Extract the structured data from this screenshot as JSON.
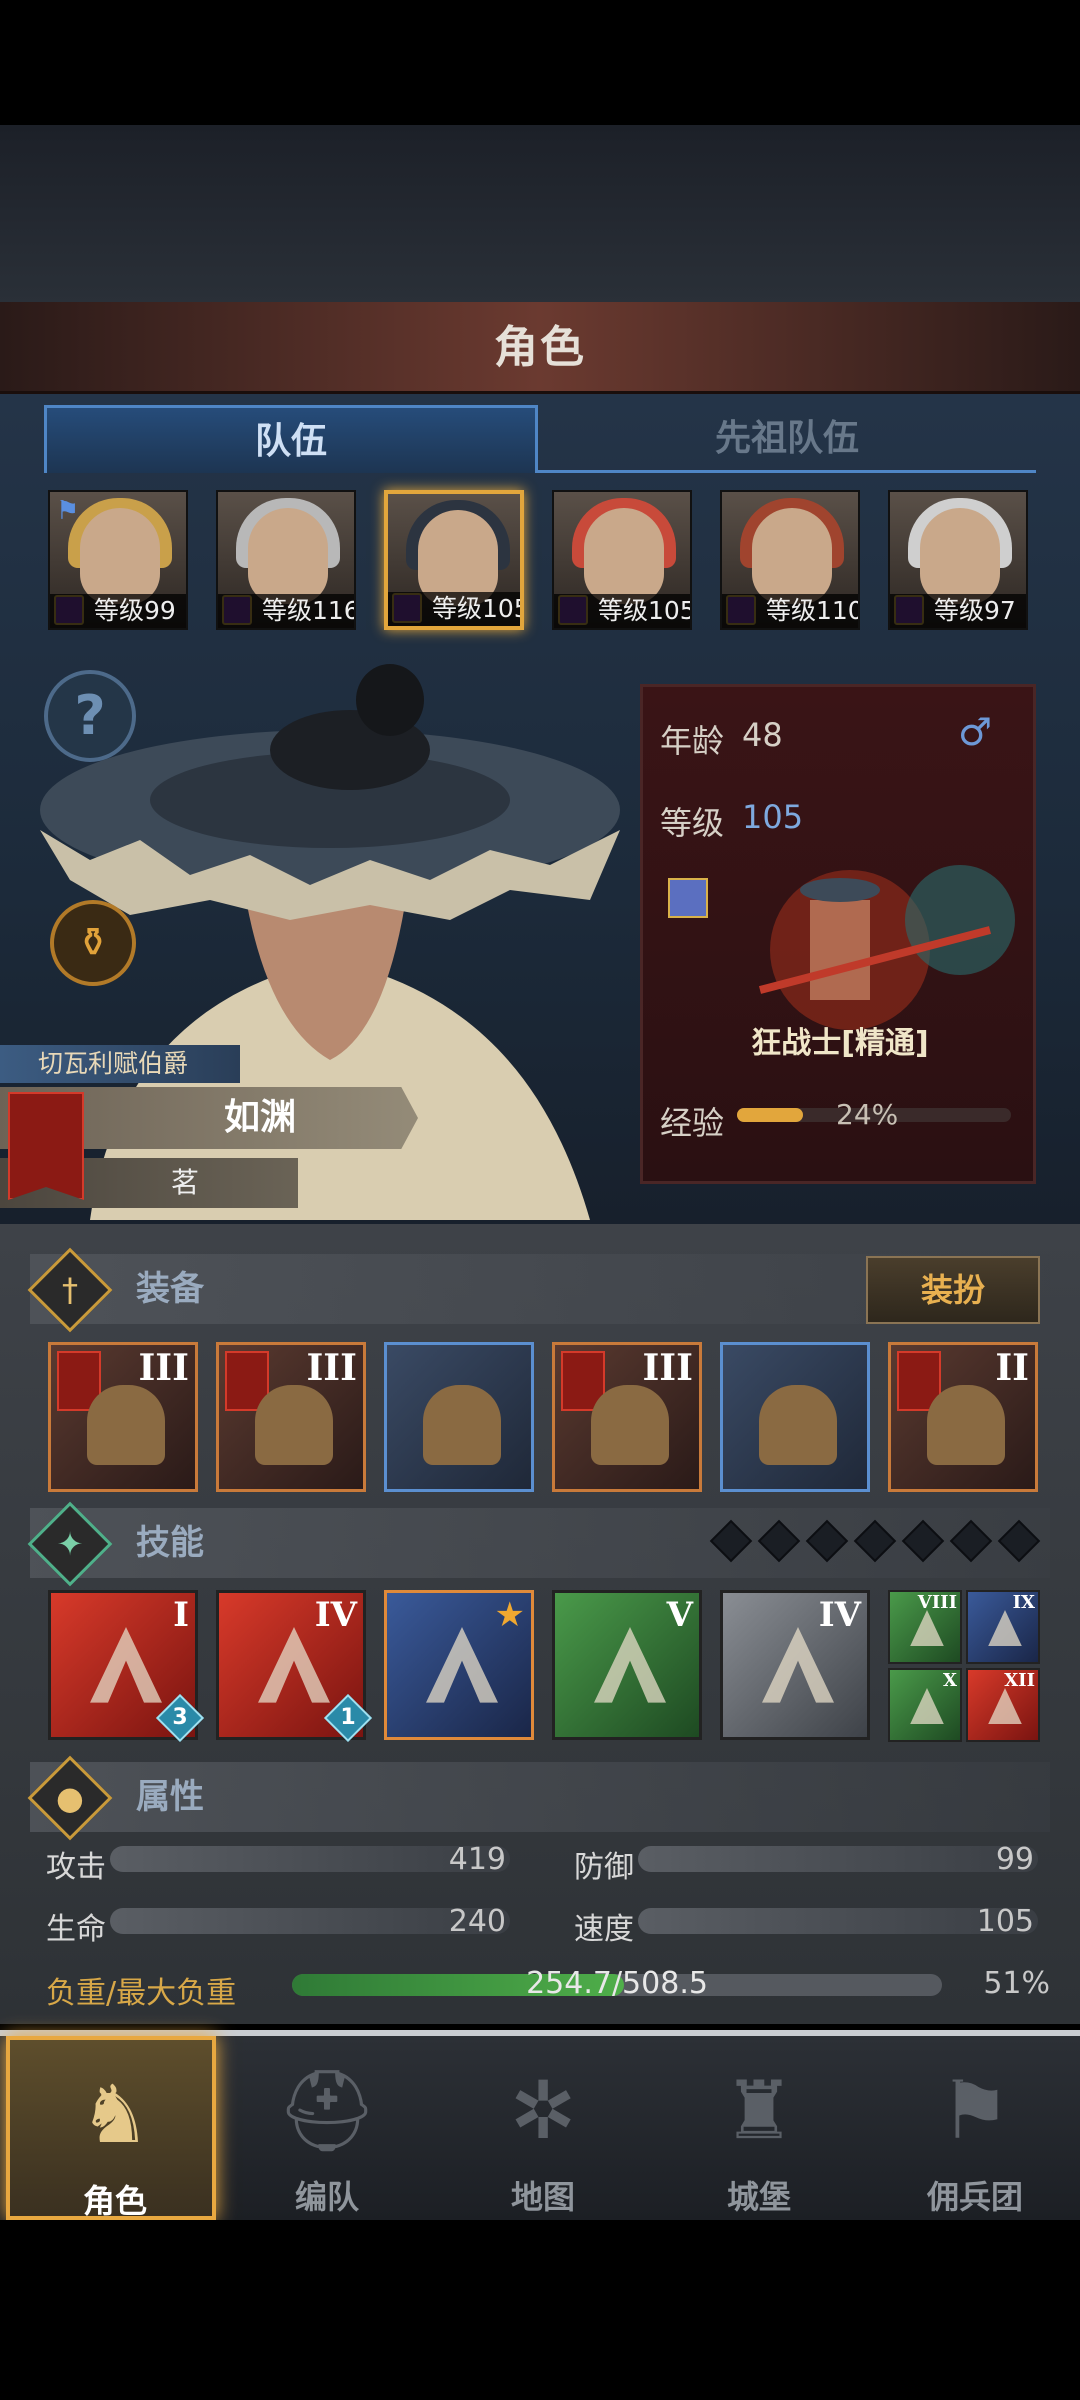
{
  "header": {
    "title": "角色"
  },
  "tabs": [
    {
      "label": "队伍",
      "active": true
    },
    {
      "label": "先祖队伍",
      "active": false
    }
  ],
  "party": [
    {
      "level_text": "等级99",
      "has_flag": true,
      "selected": false,
      "hair": "#c9a04a"
    },
    {
      "level_text": "等级116",
      "has_flag": false,
      "selected": false,
      "hair": "#b8b8b8"
    },
    {
      "level_text": "等级105",
      "has_flag": false,
      "selected": true,
      "hair": "#2c3440"
    },
    {
      "level_text": "等级105",
      "has_flag": false,
      "selected": false,
      "hair": "#c84a3a"
    },
    {
      "level_text": "等级110",
      "has_flag": false,
      "selected": false,
      "hair": "#a0442e"
    },
    {
      "level_text": "等级97",
      "has_flag": false,
      "selected": false,
      "hair": "#cfcfcf"
    }
  ],
  "character": {
    "title": "切瓦利赋伯爵",
    "name": "如渊",
    "surname": "茗",
    "age_label": "年龄",
    "age": "48",
    "gender": "♂",
    "level_label": "等级",
    "level": "105",
    "class_name": "狂战士[精通]",
    "exp_label": "经验",
    "exp_percent": "24%",
    "exp_fraction": 0.24
  },
  "equipment": {
    "label": "装备",
    "dress_button": "装扮",
    "slots": [
      {
        "tier": "III",
        "rarity": "orange"
      },
      {
        "tier": "III",
        "rarity": "orange"
      },
      {
        "tier": "",
        "rarity": "blue"
      },
      {
        "tier": "III",
        "rarity": "orange"
      },
      {
        "tier": "",
        "rarity": "blue"
      },
      {
        "tier": "II",
        "rarity": "orange"
      }
    ]
  },
  "skills": {
    "label": "技能",
    "main": [
      {
        "tier": "I",
        "badge": "3",
        "color": "red"
      },
      {
        "tier": "IV",
        "badge": "1",
        "color": "red"
      },
      {
        "tier": "",
        "badge": "",
        "color": "blue"
      },
      {
        "tier": "V",
        "badge": "",
        "color": "green"
      },
      {
        "tier": "IV",
        "badge": "",
        "color": "gray"
      }
    ],
    "mini": [
      {
        "tier": "VIII",
        "color": "green"
      },
      {
        "tier": "IX",
        "color": "blue"
      },
      {
        "tier": "X",
        "color": "green"
      },
      {
        "tier": "XII",
        "color": "red"
      }
    ],
    "diamond_count": 7
  },
  "attributes": {
    "label": "属性",
    "attack_label": "攻击",
    "attack": "419",
    "defense_label": "防御",
    "defense": "99",
    "hp_label": "生命",
    "hp": "240",
    "speed_label": "速度",
    "speed": "105",
    "load_label": "负重/最大负重",
    "load": "254.7/508.5",
    "load_percent": "51%",
    "load_fraction": 0.51
  },
  "nav": [
    {
      "label": "角色",
      "icon": "knight-icon",
      "active": true
    },
    {
      "label": "编队",
      "icon": "helmet-icon",
      "active": false
    },
    {
      "label": "地图",
      "icon": "compass-icon",
      "active": false
    },
    {
      "label": "城堡",
      "icon": "castle-icon",
      "active": false
    },
    {
      "label": "佣兵团",
      "icon": "banner-icon",
      "active": false
    }
  ]
}
